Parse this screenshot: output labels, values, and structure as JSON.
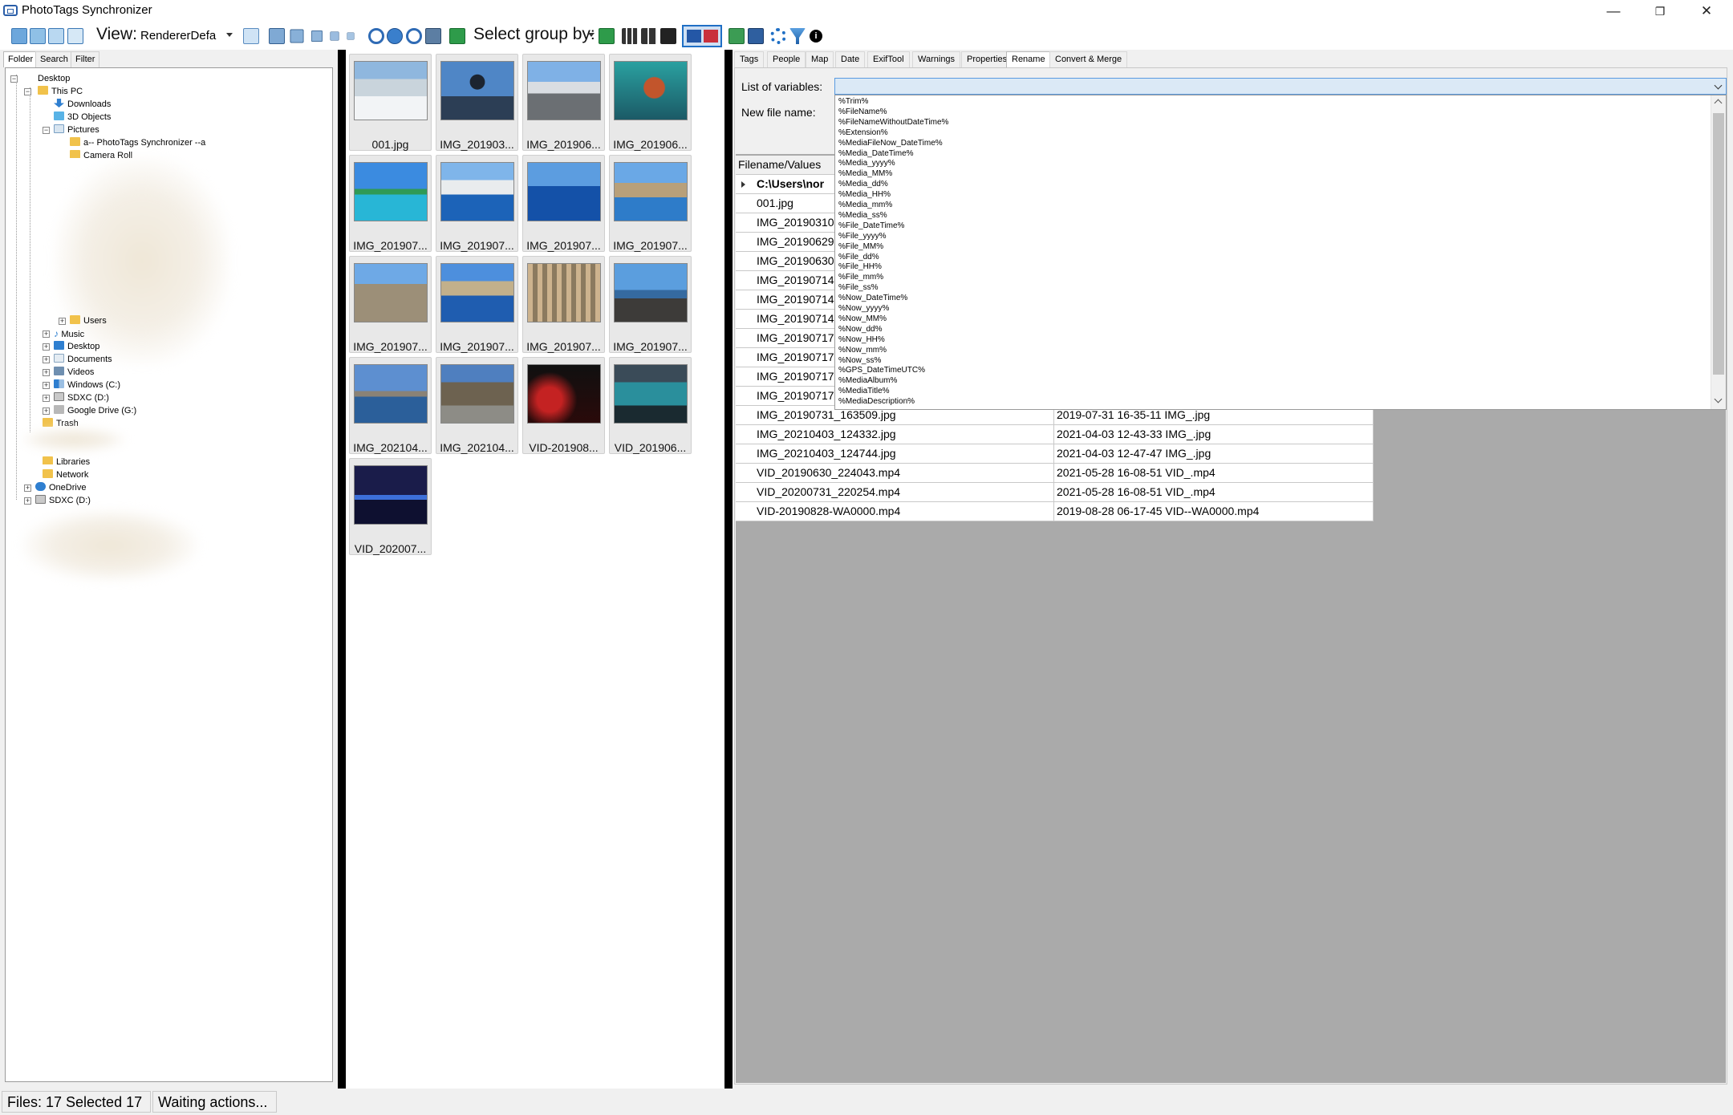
{
  "window": {
    "title": "PhotoTags Synchronizer",
    "minimize": "—",
    "maximize": "❐",
    "close": "✕"
  },
  "toolbar": {
    "view_label": "View:",
    "view_value": "RendererDefa",
    "group_label": "Select group by:"
  },
  "left_tabs": [
    "Folder",
    "Search",
    "Filter"
  ],
  "tree": {
    "desktop": "Desktop",
    "this_pc": "This PC",
    "downloads": "Downloads",
    "objects3d": "3D Objects",
    "pictures": "Pictures",
    "phototags_folder": "a-- PhotoTags Synchronizer --a",
    "camera_roll": "Camera Roll",
    "users": "Users",
    "music": "Music",
    "desktop2": "Desktop",
    "documents": "Documents",
    "videos": "Videos",
    "windows_c": "Windows (C:)",
    "sdxc_d": "SDXC (D:)",
    "google_drive": "Google Drive (G:)",
    "trash": "Trash",
    "libraries": "Libraries",
    "network": "Network",
    "onedrive": "OneDrive",
    "sdxc_d2": "SDXC (D:)"
  },
  "thumbnails": [
    {
      "caption": "001.jpg",
      "scene": "snow"
    },
    {
      "caption": "IMG_201903...",
      "scene": "statue"
    },
    {
      "caption": "IMG_201906...",
      "scene": "promenade"
    },
    {
      "caption": "IMG_201906...",
      "scene": "aquarium"
    },
    {
      "caption": "IMG_201907...",
      "scene": "pool"
    },
    {
      "caption": "IMG_201907...",
      "scene": "coast-town"
    },
    {
      "caption": "IMG_201907...",
      "scene": "sea"
    },
    {
      "caption": "IMG_201907...",
      "scene": "bay"
    },
    {
      "caption": "IMG_201907...",
      "scene": "ruins"
    },
    {
      "caption": "IMG_201907...",
      "scene": "cliffs"
    },
    {
      "caption": "IMG_201907...",
      "scene": "columns"
    },
    {
      "caption": "IMG_201907...",
      "scene": "beach"
    },
    {
      "caption": "IMG_202104...",
      "scene": "lake"
    },
    {
      "caption": "IMG_202104...",
      "scene": "trees"
    },
    {
      "caption": "VID-201908...",
      "scene": "dark-red"
    },
    {
      "caption": "VID_201906...",
      "scene": "aquarium2"
    },
    {
      "caption": "VID_202007...",
      "scene": "night-city"
    }
  ],
  "right_tabs": [
    "Tags",
    "People",
    "Map",
    "Date",
    "ExifTool",
    "Warnings",
    "Properties",
    "Rename",
    "Convert & Merge"
  ],
  "rename": {
    "list_label": "List of variables:",
    "newname_label": "New file name:",
    "variables": [
      "%Trim%",
      "%FileName%",
      "%FileNameWithoutDateTime%",
      "%Extension%",
      "%MediaFileNow_DateTime%",
      "%Media_DateTime%",
      "%Media_yyyy%",
      "%Media_MM%",
      "%Media_dd%",
      "%Media_HH%",
      "%Media_mm%",
      "%Media_ss%",
      "%File_DateTime%",
      "%File_yyyy%",
      "%File_MM%",
      "%File_dd%",
      "%File_HH%",
      "%File_mm%",
      "%File_ss%",
      "%Now_DateTime%",
      "%Now_yyyy%",
      "%Now_MM%",
      "%Now_dd%",
      "%Now_HH%",
      "%Now_mm%",
      "%Now_ss%",
      "%GPS_DateTimeUTC%",
      "%MediaAlbum%",
      "%MediaTitle%",
      "%MediaDescription%"
    ]
  },
  "grid": {
    "header": "Filename/Values",
    "folder_row": "C:\\Users\\nor",
    "rows": [
      {
        "name": "001.jpg",
        "value": ""
      },
      {
        "name": "IMG_20190310",
        "value": ""
      },
      {
        "name": "IMG_20190629",
        "value": ""
      },
      {
        "name": "IMG_20190630",
        "value": ""
      },
      {
        "name": "IMG_20190714",
        "value": ""
      },
      {
        "name": "IMG_20190714",
        "value": ""
      },
      {
        "name": "IMG_20190714",
        "value": ""
      },
      {
        "name": "IMG_20190717",
        "value": ""
      },
      {
        "name": "IMG_20190717",
        "value": ""
      },
      {
        "name": "IMG_20190717",
        "value": ""
      },
      {
        "name": "IMG_20190717",
        "value": ""
      },
      {
        "name": "IMG_20190731_163509.jpg",
        "value": "2019-07-31 16-35-11 IMG_.jpg"
      },
      {
        "name": "IMG_20210403_124332.jpg",
        "value": "2021-04-03 12-43-33 IMG_.jpg"
      },
      {
        "name": "IMG_20210403_124744.jpg",
        "value": "2021-04-03 12-47-47 IMG_.jpg"
      },
      {
        "name": "VID_20190630_224043.mp4",
        "value": "2021-05-28 16-08-51 VID_.mp4"
      },
      {
        "name": "VID_20200731_220254.mp4",
        "value": "2021-05-28 16-08-51 VID_.mp4"
      },
      {
        "name": "VID-20190828-WA0000.mp4",
        "value": "2019-08-28 06-17-45 VID--WA0000.mp4"
      }
    ]
  },
  "status": {
    "files": "Files: 17 Selected 17",
    "state": "Waiting actions..."
  },
  "colors": {
    "accent": "#1f6fc5",
    "selection_blue": "#dbe9f6",
    "grid_gray": "#aaaaaa"
  }
}
